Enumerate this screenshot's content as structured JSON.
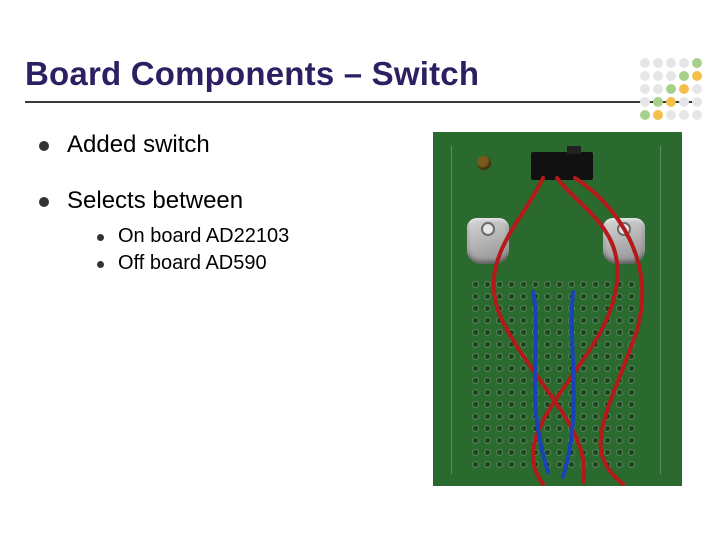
{
  "title": "Board Components – Switch",
  "bullets": {
    "b1": "Added switch",
    "b2": "Selects between",
    "sub": {
      "s1": "On board AD22103",
      "s2": "Off board AD590"
    }
  },
  "decor": {
    "dot_colors": [
      "#e6e6e6",
      "#e6e6e6",
      "#e6e6e6",
      "#e6e6e6",
      "#a7d08c",
      "#e6e6e6",
      "#e6e6e6",
      "#e6e6e6",
      "#a7d08c",
      "#f4c04a",
      "#e6e6e6",
      "#e6e6e6",
      "#a7d08c",
      "#f4c04a",
      "#e6e6e6",
      "#e6e6e6",
      "#a7d08c",
      "#f4c04a",
      "#e6e6e6",
      "#e6e6e6",
      "#a7d08c",
      "#f4c04a",
      "#e6e6e6",
      "#e6e6e6",
      "#e6e6e6"
    ]
  },
  "image": {
    "alt": "Photo of a green PCB with a small slide switch, two metal clips, and red and blue wires"
  }
}
